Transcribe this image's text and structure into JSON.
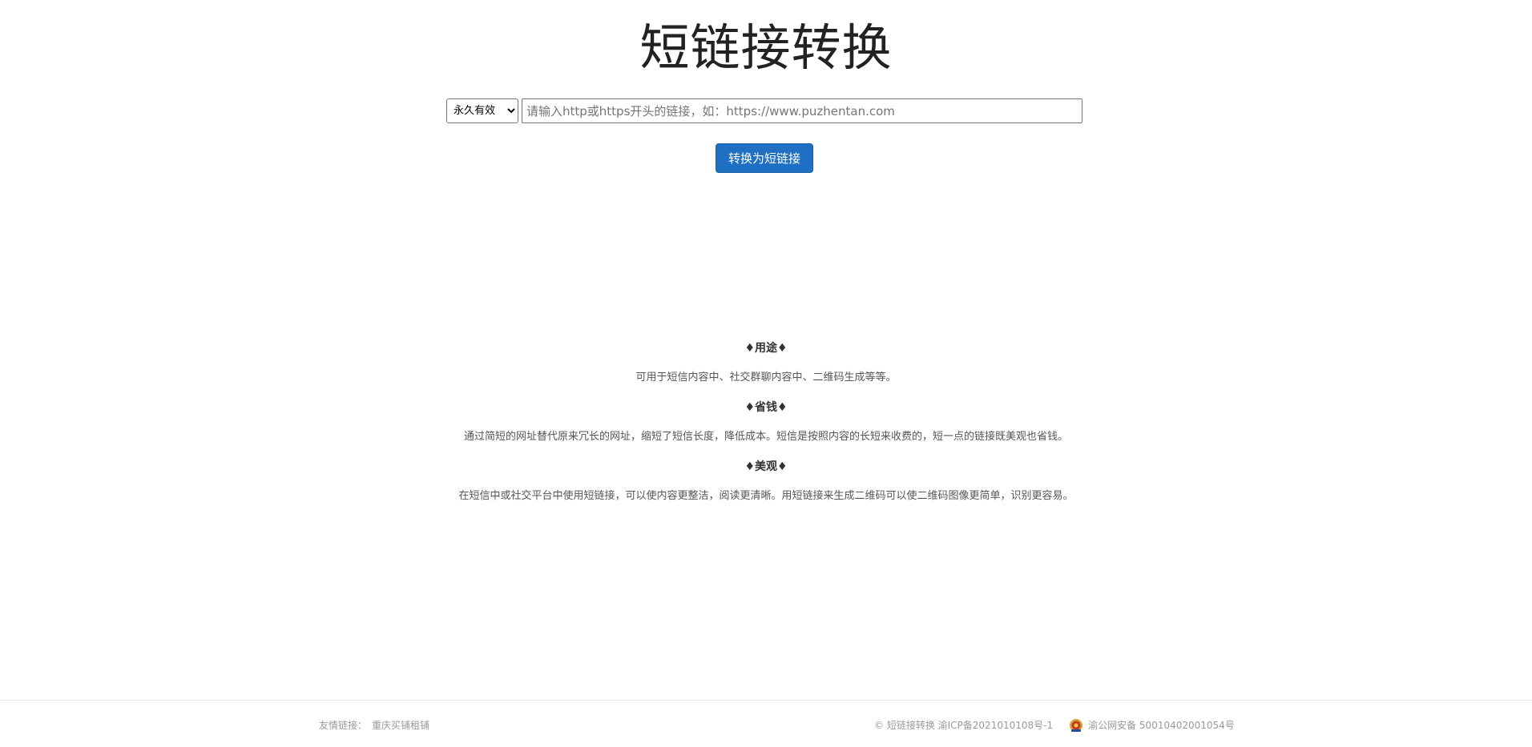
{
  "header": {
    "title": "短链接转换"
  },
  "form": {
    "validity_options": [
      "永久有效"
    ],
    "validity_selected": "永久有效",
    "url_placeholder": "请输入http或https开头的链接，如：https://www.puzhentan.com",
    "url_value": "",
    "submit_label": "转换为短链接"
  },
  "info": [
    {
      "heading": "♦用途♦",
      "text": "可用于短信内容中、社交群聊内容中、二维码生成等等。"
    },
    {
      "heading": "♦省钱♦",
      "text": "通过简短的网址替代原来冗长的网址，缩短了短信长度，降低成本。短信是按照内容的长短来收费的，短一点的链接既美观也省钱。"
    },
    {
      "heading": "♦美观♦",
      "text": "在短信中或社交平台中使用短链接，可以使内容更整洁，阅读更清晰。用短链接来生成二维码可以使二维码图像更简单，识别更容易。"
    }
  ],
  "footer": {
    "friend_links_label": "友情链接：",
    "friend_link": "重庆买铺租铺",
    "icp": "© 短链接转换 渝ICP备2021010108号-1",
    "police_icon": "police-badge-icon",
    "police_record": "渝公网安备 50010402001054号"
  }
}
